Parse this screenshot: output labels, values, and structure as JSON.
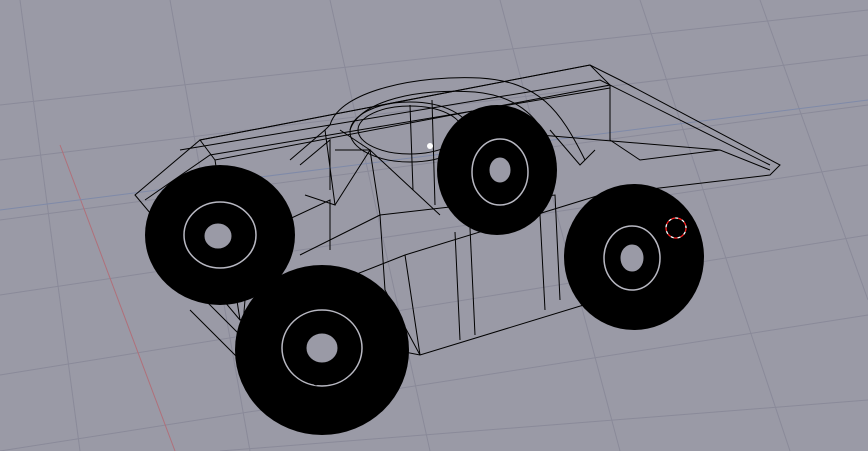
{
  "viewport": {
    "mode": "wireframe",
    "background_color": "#9a9aa6",
    "grid_color": "#8a8a99",
    "x_axis_color": "#b0707a",
    "y_axis_color": "#7f8aa8",
    "wire_color": "#000000"
  },
  "model": {
    "object": "six-wheel-armored-vehicle-wireframe",
    "wheels_visible": 4
  },
  "icons": {
    "cursor_3d": "3d-cursor-icon",
    "pivot": "pivot-point-icon"
  }
}
